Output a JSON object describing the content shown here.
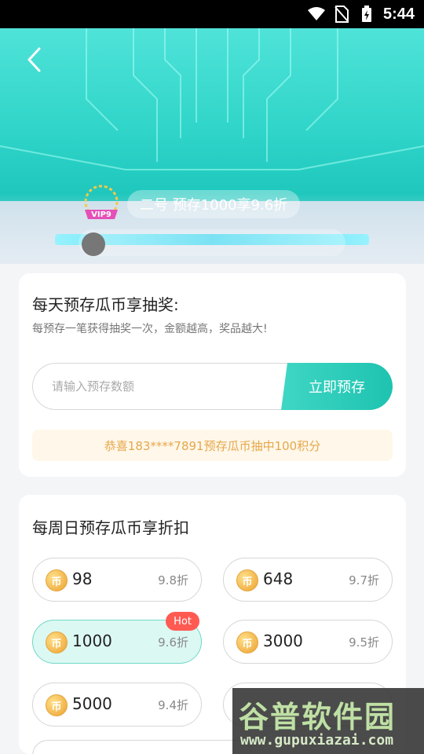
{
  "status_bar": {
    "time": "5:44"
  },
  "banner": {
    "ticker_text": "二号  预存1000享9.6折",
    "vip_label": "VIP9"
  },
  "lottery_card": {
    "title": "每天预存瓜币享抽奖:",
    "subtitle": "每预存一笔获得抽奖一次，金额越高，奖品越大!",
    "input_placeholder": "请输入预存数额",
    "input_value": "",
    "button_label": "立即预存",
    "notice": "恭喜183****7891预存瓜币抽中100积分"
  },
  "discount_card": {
    "title": "每周日预存瓜币享折扣",
    "coin_symbol": "币",
    "options": [
      {
        "amount": "98",
        "discount": "9.8折",
        "selected": false,
        "badge": ""
      },
      {
        "amount": "648",
        "discount": "9.7折",
        "selected": false,
        "badge": ""
      },
      {
        "amount": "1000",
        "discount": "9.6折",
        "selected": true,
        "badge": "Hot"
      },
      {
        "amount": "3000",
        "discount": "9.5折",
        "selected": false,
        "badge": ""
      },
      {
        "amount": "5000",
        "discount": "9.4折",
        "selected": false,
        "badge": ""
      }
    ]
  },
  "watermark": {
    "main": "谷普软件园",
    "url": "www.gupuxiazai.com"
  },
  "colors": {
    "accent": "#1ec3b0",
    "hot": "#ff5a52",
    "notice_text": "#e6a84a"
  }
}
